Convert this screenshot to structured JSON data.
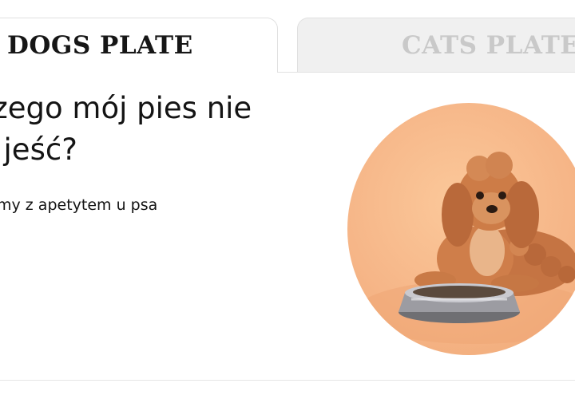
{
  "tabs": [
    {
      "label": "DOGS PLATE",
      "active": true
    },
    {
      "label": "CATS PLATE",
      "active": false
    }
  ],
  "article": {
    "headline_line1": "czego mój pies nie",
    "headline_line2": "e jeść?",
    "subline": "my z apetytem u psa"
  },
  "colors": {
    "active_tab_text": "#161616",
    "inactive_tab_text": "#c9c9c9",
    "inactive_tab_bg": "#f0f0f0",
    "photo_background": "#f6b688",
    "dog_fur": "#c8743f"
  },
  "image": {
    "subject": "dog-with-bowl"
  }
}
